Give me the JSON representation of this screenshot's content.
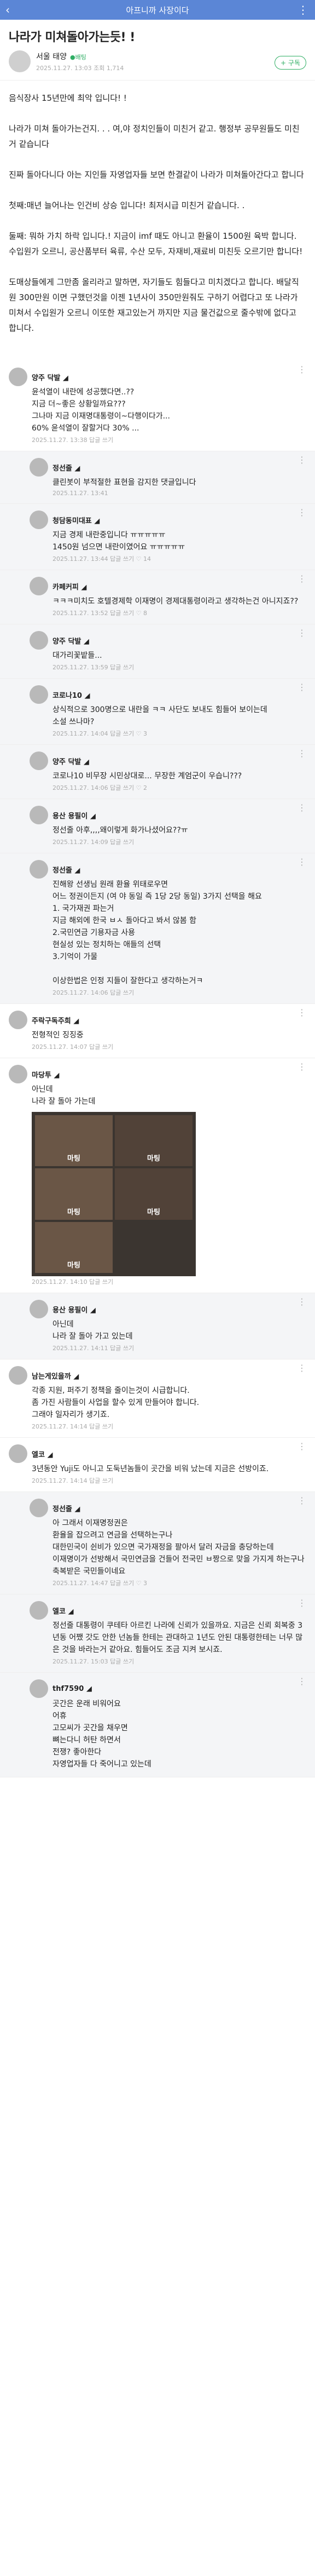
{
  "topbar": {
    "title": "아프니까 사장이다",
    "back": "‹",
    "more": "⋮"
  },
  "post": {
    "title": "나라가 미쳐돌아가는듯! !",
    "author": "서울 태양",
    "badge": "●배팅",
    "meta": "2025.11.27. 13:03  조회 1,714",
    "follow": "+ 구독"
  },
  "paragraphs": [
    "음식장사 15년만에 최악 입니다! !",
    "나라가 미쳐 돌아가는건지. . . 여,야 정치인들이 미친거 같고. 행정부 공무원들도 미친거 같습니다",
    "진짜 돌아다니다 아는 지인들 자영업자들 보면 한결같이 나라가 미쳐돌아간다고 합니다",
    "첫째:매년 늘어나는 인건비 상승 입니다! 최저시급 미친거 같습니다. .",
    "둘째: 뭐하 가치 하락 입니다.! 지금이 imf 때도 아니고 환율이 1500원 육박 합니다. 수입원가 오르니, 공산품부터 육류, 수산 모두, 자재비,재료비 미친듯 오르기만 합니다!",
    "도매상들에게 그만좀 올리라고 말하면, 자기들도 힘들다고 미치겠다고 합니다. 배달직원 300만원 이면 구했던것을 이젠 1년사이 350만원줘도 구하기 어렵다고 또 나라가 미쳐서 수입원가 오르니 이또한 재고있는거 까지만 지금 물건값으로 줄수밖에 없다고 합니다."
  ],
  "comments": [
    {
      "name": "양주 닥발 ◢",
      "text": "윤석열이 내란에 성공했다면..??\n지금 더~좋은 상황일까요???\n그나마 지금 이재명대통령이~다행이다가...\n60% 윤석열이 잘할거다 30% ...",
      "meta": "2025.11.27. 13:38  답글 쓰기",
      "reply": false
    },
    {
      "name": "정선줄 ◢",
      "text": "클린봇이 부적절한 표현을 감지한 댓글입니다",
      "meta": "2025.11.27. 13:41",
      "reply": true
    },
    {
      "name": "청담동미대표 ◢",
      "text": "지금 경제 내란중입니다 ㅠㅠㅠㅠㅠ\n1450원 넘으면 내란이였어요 ㅠㅠㅠㅠㅠ",
      "meta": "2025.11.27. 13:44  답글 쓰기  ♡ 14",
      "reply": true
    },
    {
      "name": "카페커피 ◢",
      "text": "ㅋㅋㅋ미치도 호텔경제학 이재명이 경제대통령이라고 생각하는건 아니지죠??",
      "meta": "2025.11.27. 13:52  답글 쓰기  ♡ 8",
      "reply": true
    },
    {
      "name": "양주 닥발 ◢",
      "text": "대가리꽃밭들...",
      "meta": "2025.11.27. 13:59  답글 쓰기",
      "reply": true
    },
    {
      "name": "코로나10 ◢",
      "text": "상식적으로 300명으로 내란을 ㅋㅋ 사단도 보내도 힘들어 보이는데\n소설 쓰나마?",
      "meta": "2025.11.27. 14:04  답글 쓰기  ♡ 3",
      "reply": true
    },
    {
      "name": "양주 닥발 ◢",
      "text": "코로나10 비무장 시민상대로... 무장한 계엄군이 우습니???",
      "meta": "2025.11.27. 14:06  답글 쓰기  ♡ 2",
      "reply": true
    },
    {
      "name": "용산 용필이 ◢",
      "text": "정선줄 아후,,,,왜이렇게 화가나셨어요??ㅠ",
      "meta": "2025.11.27. 14:09  답글 쓰기",
      "reply": true
    },
    {
      "name": "정선줄 ◢",
      "text": "진해왕 선생님 원래 환율 위태로우면\n어느 정권이든지 (여 야 동일 즉 1당 2당 동일) 3가지 선택을 해요\n1. 국가재권 파는거\n지금 해외에 한국 ㅂㅅ 돌아다고 봐서 않봄 함\n2.국민연금 기용자금 사용\n현실성 있는 정치하는 애들의 선택\n3.기억이 가물\n\n이상한법은 인정 지들이 잘한다고 생각하는거ㅋ",
      "meta": "2025.11.27. 14:06  답글 쓰기",
      "reply": true
    },
    {
      "name": "주락구독주희 ◢",
      "text": "전형적인 징징중",
      "meta": "2025.11.27. 14:07  답글 쓰기",
      "reply": false
    },
    {
      "name": "마당투 ◢",
      "text": "아닌데\n나라 잘 돌아 가는데",
      "meta": "2025.11.27. 14:10  답글 쓰기",
      "reply": false,
      "image": true
    },
    {
      "name": "용산 용필이 ◢",
      "text": "아닌데\n나라 잘 돌아 가고 있는데",
      "meta": "2025.11.27. 14:11  답글 쓰기",
      "reply": true
    },
    {
      "name": "남는게있을까 ◢",
      "text": "각종 지원, 퍼주기 정책을 줄이는것이 시급합니다.\n좀 가진 사람들이 사업을 할수 있게 만들어야 합니다.\n그래야 일자리가 생기죠.",
      "meta": "2025.11.27. 14:14  답글 쓰기",
      "reply": false
    },
    {
      "name": "엘코 ◢",
      "text": "3년동안 Yuji도 아니고 도둑년놈들이 곳간을 비워 났는데 지금은 선방이죠.",
      "meta": "2025.11.27. 14:14  답글 쓰기",
      "reply": false
    },
    {
      "name": "정선줄 ◢",
      "text": "아 그래서 이재명정권은\n환율을 잡으려고 연금을 선택하는구나\n대한민국이 쉰비가 있으면 국가재정을 팔아서 달러 자금을 충당하는데\n이재명이가 선방해서 국민연금을 건들어 전국민 ㅂ짱으로 맞을 가지게 하는구나 축복받은 국민들이네요",
      "meta": "2025.11.27. 14:47  답글 쓰기  ♡ 3",
      "reply": true
    },
    {
      "name": "엘코 ◢",
      "text": "정선줄 대통령이 쿠테타 아르킨 나라에 신뢰가 있을까요. 지금은 신뢰 회복중 3년동 어쨌 갓도 안한 넌놈들 한테는 관대하고 1년도 안된 대통령한테는 너무 많은 것을 바라는거 같아요. 힘들어도 조금 지켜 보시죠.",
      "meta": "2025.11.27. 15:03  답글 쓰기",
      "reply": true
    },
    {
      "name": "thf7590 ◢",
      "text": "곳간은 운래 비워어요\n어휴\n고모씨가 곳간을 채우면\n뼈는다니 허탄 하면서\n전쟁? 좋아한다\n자영업자들 다 죽어니고 있는데",
      "meta": "",
      "reply": true
    }
  ],
  "image_labels": [
    "마팅",
    "마팅",
    "마팅",
    "마팅",
    "마팅"
  ]
}
